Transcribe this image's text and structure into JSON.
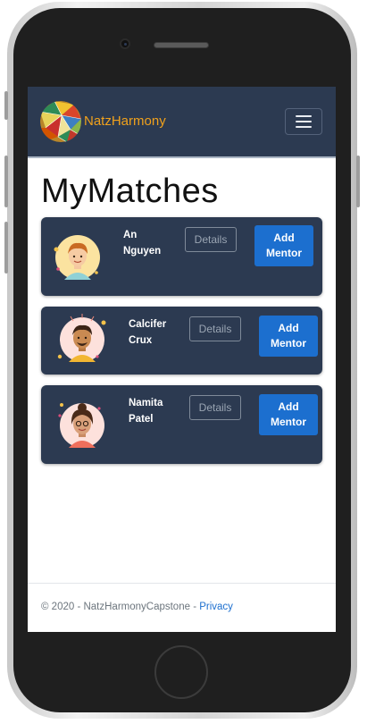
{
  "navbar": {
    "brand": "NatzHarmony"
  },
  "page": {
    "title": "MyMatches"
  },
  "matches": [
    {
      "name_line1": "An",
      "name_line2": "Nguyen",
      "details_label": "Details",
      "add_line1": "Add",
      "add_line2": "Mentor"
    },
    {
      "name_line1": "Calcifer",
      "name_line2": "Crux",
      "details_label": "Details",
      "add_line1": "Add",
      "add_line2": "Mentor"
    },
    {
      "name_line1": "Namita",
      "name_line2": "Patel",
      "details_label": "Details",
      "add_line1": "Add",
      "add_line2": "Mentor"
    }
  ],
  "footer": {
    "copyright": "© 2020 - NatzHarmonyCapstone - ",
    "privacy_link": "Privacy"
  },
  "colors": {
    "navbar": "#2c3a51",
    "brand": "#f0a11c",
    "primary": "#1c6fcf"
  },
  "icons": [
    "hamburger-icon",
    "logo-globe-icon",
    "avatar-icon"
  ]
}
